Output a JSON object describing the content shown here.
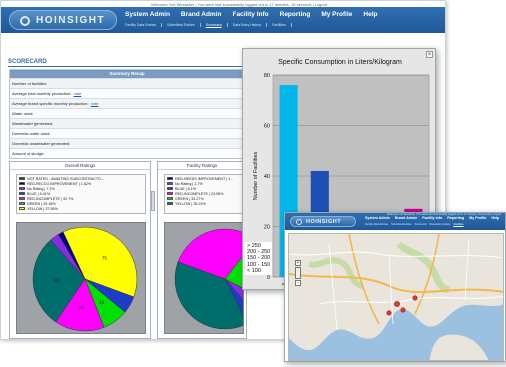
{
  "app": {
    "logo_text": "HOINSIGHT",
    "top_line": "Welcome Yun Wexacker | You were last successfully logged out in 17 minutes, 15 seconds | Logout",
    "nav": [
      "System Admin",
      "Brand Admin",
      "Facility Info",
      "Reporting",
      "My Profile",
      "Help"
    ],
    "subnav": [
      "Facility Data Entries",
      "Submitted Entries",
      "Scorecard",
      "Data Entry History",
      "Facilities"
    ],
    "subnav_active": "Scorecard"
  },
  "scorecard": {
    "title": "SCORECARD",
    "summary_heading": "Summary Recap",
    "rows": [
      {
        "label": "Number of facilities:",
        "link": ""
      },
      {
        "label": "Average total monthly production:",
        "link": "note"
      },
      {
        "label": "Average brand specific monthly production:",
        "link": "note"
      },
      {
        "label": "Water used:",
        "link": ""
      },
      {
        "label": "Wastewater generated:",
        "link": ""
      },
      {
        "label": "Domestic water used:",
        "link": ""
      },
      {
        "label": "Domestic wastewater generated:",
        "link": ""
      },
      {
        "label": "Amount of sludge:",
        "link": ""
      }
    ]
  },
  "overall_ratings": {
    "title": "Overall Ratings",
    "legend": [
      {
        "label": "NOT RATED - AWAITING SUBCONTRACTO...",
        "color": "#006400"
      },
      {
        "label": "RED-RECCO IMPROVEMENT | 1.62%",
        "color": "#00008b"
      },
      {
        "label": "No Rating | 7.1%",
        "color": "#8a2be2"
      },
      {
        "label": "BLUE | 5.41%",
        "color": "#1e3cc8"
      },
      {
        "label": "RED-INCOMPLETE | 32.7%",
        "color": "#ff00ff"
      },
      {
        "label": "GREEN | 29.18%",
        "color": "#00e000"
      },
      {
        "label": "YELLOW | 37.55%",
        "color": "#ffff00"
      }
    ],
    "slices": [
      {
        "label": "YELLOW",
        "percent": 37.55,
        "color": "#ffff00",
        "text": "75"
      },
      {
        "label": "BLUE",
        "percent": 5.41,
        "color": "#1e3cc8",
        "text": ""
      },
      {
        "label": "GREEN",
        "percent": 8.0,
        "color": "#00e000",
        "text": "16"
      },
      {
        "label": "RED-INCOMPLETE",
        "percent": 15.5,
        "color": "#ff00ff",
        "text": "31"
      },
      {
        "label": "NOT RATED",
        "percent": 29.0,
        "color": "#006d6d",
        "text": "58"
      },
      {
        "label": "No Rating",
        "percent": 2.9,
        "color": "#8a2be2",
        "text": ""
      },
      {
        "label": "RED-RECCO IMPROVEMENT",
        "percent": 1.62,
        "color": "#00008b",
        "text": ""
      }
    ]
  },
  "facility_ratings": {
    "title": "Facility Ratings",
    "legend": [
      {
        "label": "RED-NEEDS IMPROVEMENT | 1...",
        "color": "#00008b"
      },
      {
        "label": "No Rating | 2.7%",
        "color": "#8a2be2"
      },
      {
        "label": "BLUE | 6.1%",
        "color": "#1e3cc8"
      },
      {
        "label": "RED-INCOMPLETE | 24.08%",
        "color": "#ff00ff"
      },
      {
        "label": "GREEN | 33.27%",
        "color": "#00e000"
      },
      {
        "label": "YELLOW | 35.22%",
        "color": "#006d6d"
      }
    ],
    "slices": [
      {
        "label": "RED-INCOMPLETE",
        "percent": 30,
        "color": "#ff00ff"
      },
      {
        "label": "GREEN",
        "percent": 22,
        "color": "#00e000"
      },
      {
        "label": "No Rating",
        "percent": 6,
        "color": "#8a2be2"
      },
      {
        "label": "BLUE",
        "percent": 4,
        "color": "#1e3cc8"
      },
      {
        "label": "YELLOW",
        "percent": 38,
        "color": "#006d6d"
      }
    ]
  },
  "chart_data": {
    "type": "bar",
    "title": "Specific Consumption in Liters/Kilogram",
    "ylabel": "Number of Facilities",
    "xlabel": "",
    "categories": [
      "< 100",
      "100 - 150",
      "150 - 200",
      "200 - 250",
      "> 250"
    ],
    "tick_labels": [
      "< 100",
      "",
      "150 - 200",
      "",
      "> 250"
    ],
    "values": [
      76,
      42,
      16,
      13,
      27
    ],
    "colors": [
      "#00b7eb",
      "#1e50b4",
      "#000096",
      "#8a2be2",
      "#c8008c"
    ],
    "ylim": [
      0,
      80
    ],
    "yticks": [
      0,
      20,
      40,
      60,
      80
    ],
    "grid": true,
    "legend": [
      "> 250",
      "200 - 250",
      "150 - 200",
      "100 - 150",
      "< 100"
    ]
  },
  "map_window": {
    "logo_text": "HOINSIGHT",
    "top_line": "Welcome Yun Wexacker | You were last successfully logged out in 17 minutes, 15 seconds | Logout",
    "nav": [
      "System Admin",
      "Brand Admin",
      "Facility Info",
      "Reporting",
      "My Profile",
      "Help"
    ],
    "subnav": [
      "Facility Data Entries",
      "Submitted Entries",
      "Scorecard",
      "Data Entry History",
      "Facilities"
    ],
    "subnav_active": "Facilities"
  }
}
